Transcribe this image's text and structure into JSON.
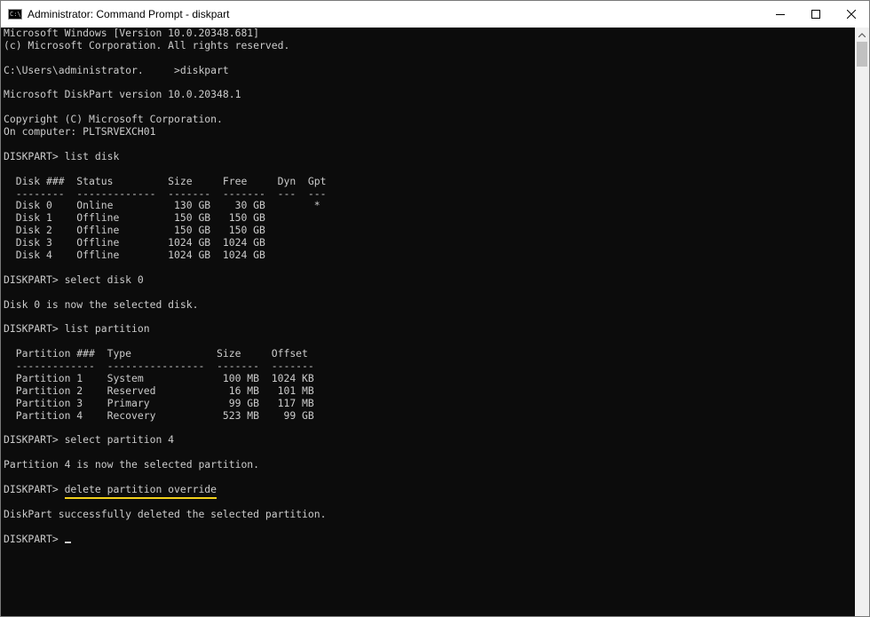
{
  "window": {
    "title": "Administrator: Command Prompt - diskpart",
    "icon_text": "C:\\",
    "controls": {
      "minimize_icon": "minimize-icon",
      "maximize_icon": "maximize-icon",
      "close_icon": "close-icon"
    }
  },
  "console": {
    "lines": [
      "Microsoft Windows [Version 10.0.20348.681]",
      "(c) Microsoft Corporation. All rights reserved.",
      "",
      "C:\\Users\\administrator.     >diskpart",
      "",
      "Microsoft DiskPart version 10.0.20348.1",
      "",
      "Copyright (C) Microsoft Corporation.",
      "On computer: PLTSRVEXCH01",
      "",
      "DISKPART> list disk",
      "",
      "  Disk ###  Status         Size     Free     Dyn  Gpt",
      "  --------  -------------  -------  -------  ---  ---",
      "  Disk 0    Online          130 GB    30 GB        *",
      "  Disk 1    Offline         150 GB   150 GB",
      "  Disk 2    Offline         150 GB   150 GB",
      "  Disk 3    Offline        1024 GB  1024 GB",
      "  Disk 4    Offline        1024 GB  1024 GB",
      "",
      "DISKPART> select disk 0",
      "",
      "Disk 0 is now the selected disk.",
      "",
      "DISKPART> list partition",
      "",
      "  Partition ###  Type              Size     Offset",
      "  -------------  ----------------  -------  -------",
      "  Partition 1    System             100 MB  1024 KB",
      "  Partition 2    Reserved            16 MB   101 MB",
      "  Partition 3    Primary             99 GB   117 MB",
      "  Partition 4    Recovery           523 MB    99 GB",
      "",
      "DISKPART> select partition 4",
      "",
      "Partition 4 is now the selected partition.",
      ""
    ],
    "highlighted_prompt": "DISKPART> ",
    "highlighted_command": "delete partition override",
    "result_lines": [
      "",
      "DiskPart successfully deleted the selected partition.",
      ""
    ],
    "final_prompt": "DISKPART> "
  },
  "colors": {
    "console_bg": "#0c0c0c",
    "console_text": "#cccccc",
    "highlight_underline": "#f2d21b"
  }
}
